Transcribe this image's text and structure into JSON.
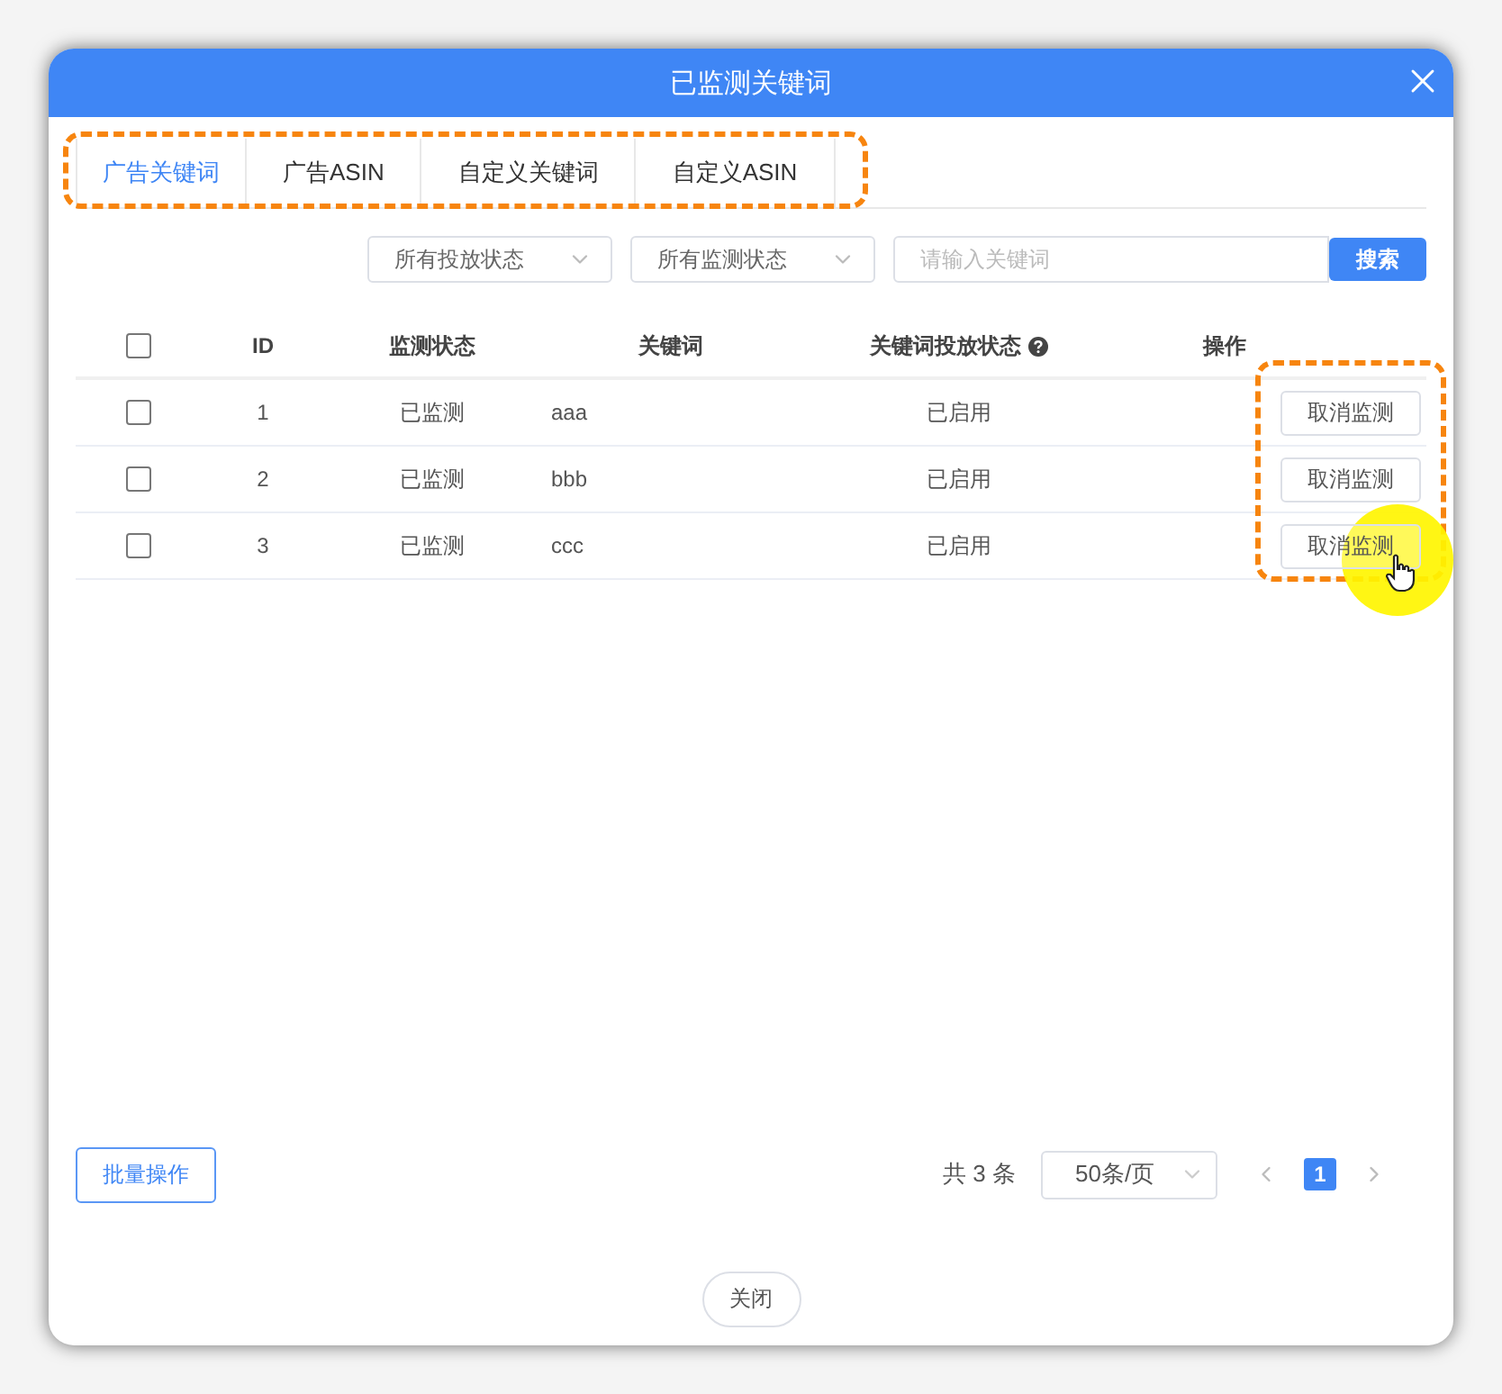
{
  "dialog": {
    "title": "已监测关键词"
  },
  "tabs": [
    {
      "label": "广告关键词",
      "selected": true
    },
    {
      "label": "广告ASIN",
      "selected": false
    },
    {
      "label": "自定义关键词",
      "selected": false
    },
    {
      "label": "自定义ASIN",
      "selected": false
    }
  ],
  "filters": {
    "selects": [
      {
        "value": "所有投放状态"
      },
      {
        "value": "所有监测状态"
      }
    ],
    "search": {
      "placeholder": "请输入关键词"
    },
    "search_button": "搜索"
  },
  "table": {
    "header_checked": false,
    "columns": [
      {
        "label": "ID",
        "help": false
      },
      {
        "label": "监测状态",
        "help": false
      },
      {
        "label": "关键词",
        "help": false
      },
      {
        "label": "关键词投放状态",
        "help": true
      },
      {
        "label": "操作",
        "help": false
      }
    ],
    "rows": [
      {
        "checked": false,
        "id": "1",
        "monitor_status": "已监测",
        "keyword": "aaa",
        "launch_status": "已启用",
        "action": "取消监测"
      },
      {
        "checked": false,
        "id": "2",
        "monitor_status": "已监测",
        "keyword": "bbb",
        "launch_status": "已启用",
        "action": "取消监测"
      },
      {
        "checked": false,
        "id": "3",
        "monitor_status": "已监测",
        "keyword": "ccc",
        "launch_status": "已启用",
        "action": "取消监测"
      }
    ]
  },
  "footer": {
    "batch_button": "批量操作",
    "total": "共 3 条",
    "page_size": "50条/页",
    "pages": [
      {
        "label": "1",
        "selected": true
      }
    ],
    "close_button": "关闭"
  }
}
